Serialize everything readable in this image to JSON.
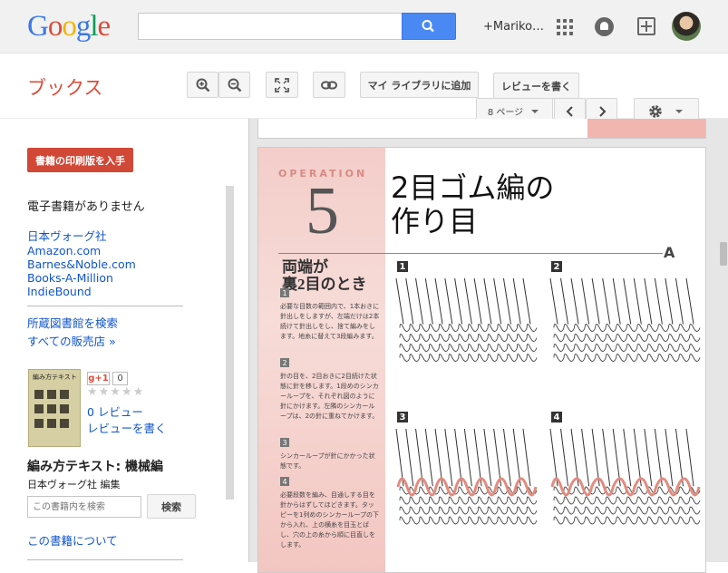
{
  "header": {
    "logo_letters": [
      {
        "ch": "G",
        "color": "#3b78e7"
      },
      {
        "ch": "o",
        "color": "#dd4b39"
      },
      {
        "ch": "o",
        "color": "#f4b400"
      },
      {
        "ch": "g",
        "color": "#3b78e7"
      },
      {
        "ch": "l",
        "color": "#0f9d58"
      },
      {
        "ch": "e",
        "color": "#dd4b39"
      }
    ],
    "search_value": "",
    "user_name": "+Mariko…",
    "icons": [
      "search-icon",
      "apps-icon",
      "notifications-icon",
      "share-icon",
      "avatar"
    ]
  },
  "toolbar": {
    "app_title": "ブックス",
    "add_to_library": "マイ ライブラリに追加",
    "write_review": "レビューを書く",
    "page_select": "8 ページ",
    "icons": [
      "zoom-in-icon",
      "zoom-out-icon",
      "fullscreen-icon",
      "link-icon",
      "chevron-left-icon",
      "chevron-right-icon",
      "gear-icon"
    ]
  },
  "sidebar": {
    "buy_button": "書籍の印刷版を入手",
    "no_ebook": "電子書籍がありません",
    "sellers": [
      "日本ヴォーグ社",
      "Amazon.com",
      "Barnes&Noble.com",
      "Books-A-Million",
      "IndieBound"
    ],
    "library_search": "所蔵図書館を検索",
    "all_sellers": "すべての販売店 »",
    "cover_title": "編み方テキスト",
    "gplus": "g+1",
    "gplus_count": "0",
    "stars": "★★★★★",
    "reviews": "0 レビュー",
    "write_review": "レビューを書く",
    "book_title": "編み方テキスト: 機械編",
    "book_author": "日本ヴォーグ社 編集",
    "search_placeholder": "この書籍内を検索",
    "search_button": "検索",
    "about": "この書籍について"
  },
  "page": {
    "operation_label": "OPERATION",
    "operation_number": "5",
    "title_line1": "2目ゴム編の",
    "title_line2": "作り目",
    "marker": "A",
    "section_title_line1": "両端が",
    "section_title_line2": "裏2目のとき",
    "steps": [
      {
        "num": "1",
        "text": "必要な目数の範囲内で、1本おきに針出しをしますが、左端だけは2本続けて針出しをし、捨て編みをします。地糸に替えて3段編みます。"
      },
      {
        "num": "2",
        "text": "針の目を、2目おきに2目続けた状態に針を移します。1段めのシンカーループを、それぞれ図のように針にかけます。左隣のシンカーループは、2の針に重ねてかけます。"
      },
      {
        "num": "3",
        "text": "シンカーループが針にかかった状態です。"
      },
      {
        "num": "4",
        "text": "必要段数を編み、目通しする目を針からはずしてほどきます。タッピーを1列めのシンカーループの下から入れ、上の横糸を目玉とばし、穴の上の糸から順に目直しをします。"
      }
    ],
    "figures": [
      "1",
      "2",
      "3",
      "4"
    ]
  }
}
